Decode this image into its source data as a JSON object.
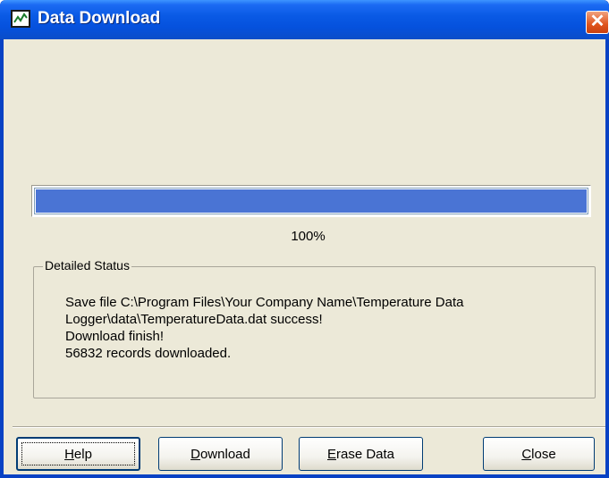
{
  "window": {
    "title": "Data Download",
    "close_glyph": "✕"
  },
  "progress": {
    "value": 1.0,
    "percent_label": "100%",
    "fill_color": "#4a74d4"
  },
  "status": {
    "group_label": "Detailed Status",
    "lines": [
      "Save file C:\\Program Files\\Your Company Name\\Temperature Data",
      "Logger\\data\\TemperatureData.dat success!",
      "Download finish!",
      "56832 records downloaded."
    ]
  },
  "buttons": {
    "help": {
      "mnemonic": "H",
      "rest": "elp"
    },
    "download": {
      "mnemonic": "D",
      "rest": "ownload"
    },
    "erase": {
      "mnemonic": "E",
      "rest": "rase Data"
    },
    "close": {
      "mnemonic": "C",
      "rest": "lose"
    }
  },
  "icons": {
    "app": "chart-icon",
    "close": "close-icon"
  },
  "colors": {
    "titlebar": "#0551dd",
    "window_bg": "#ece9d8",
    "close_button": "#e0541c"
  }
}
